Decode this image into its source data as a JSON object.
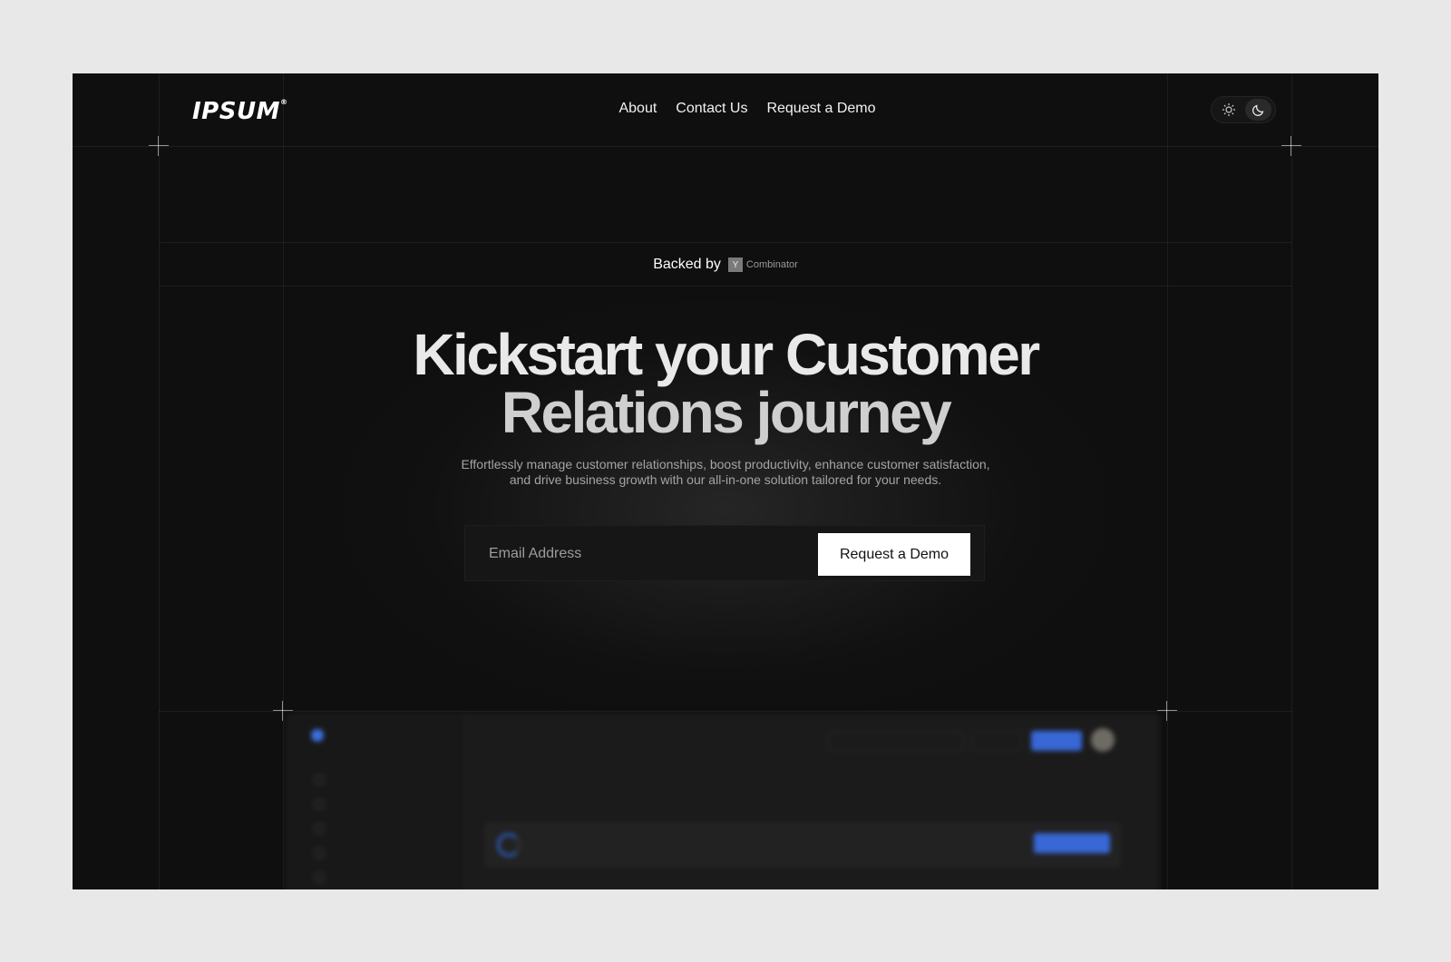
{
  "brand": {
    "name": "IPSUM"
  },
  "nav": {
    "items": [
      {
        "label": "About"
      },
      {
        "label": "Contact Us"
      },
      {
        "label": "Request a Demo"
      }
    ]
  },
  "theme_toggle": {
    "options": [
      "sun-icon",
      "moon-icon"
    ],
    "active": "moon-icon"
  },
  "backed": {
    "label": "Backed by",
    "badge_letter": "Y",
    "badge_text": "Combinator"
  },
  "hero": {
    "headline_line1": "Kickstart your Customer",
    "headline_line2": "Relations journey",
    "subtitle": "Effortlessly manage customer relationships, boost productivity, enhance customer satisfaction, and drive business growth with our all-in-one solution tailored for your needs."
  },
  "signup": {
    "email_placeholder": "Email Address",
    "email_value": "",
    "button_label": "Request a Demo"
  },
  "colors": {
    "page_background": "#e8e8e8",
    "frame_background": "#0f0f0f",
    "accent_blue": "#3867d6",
    "button_bg": "#ffffff"
  }
}
